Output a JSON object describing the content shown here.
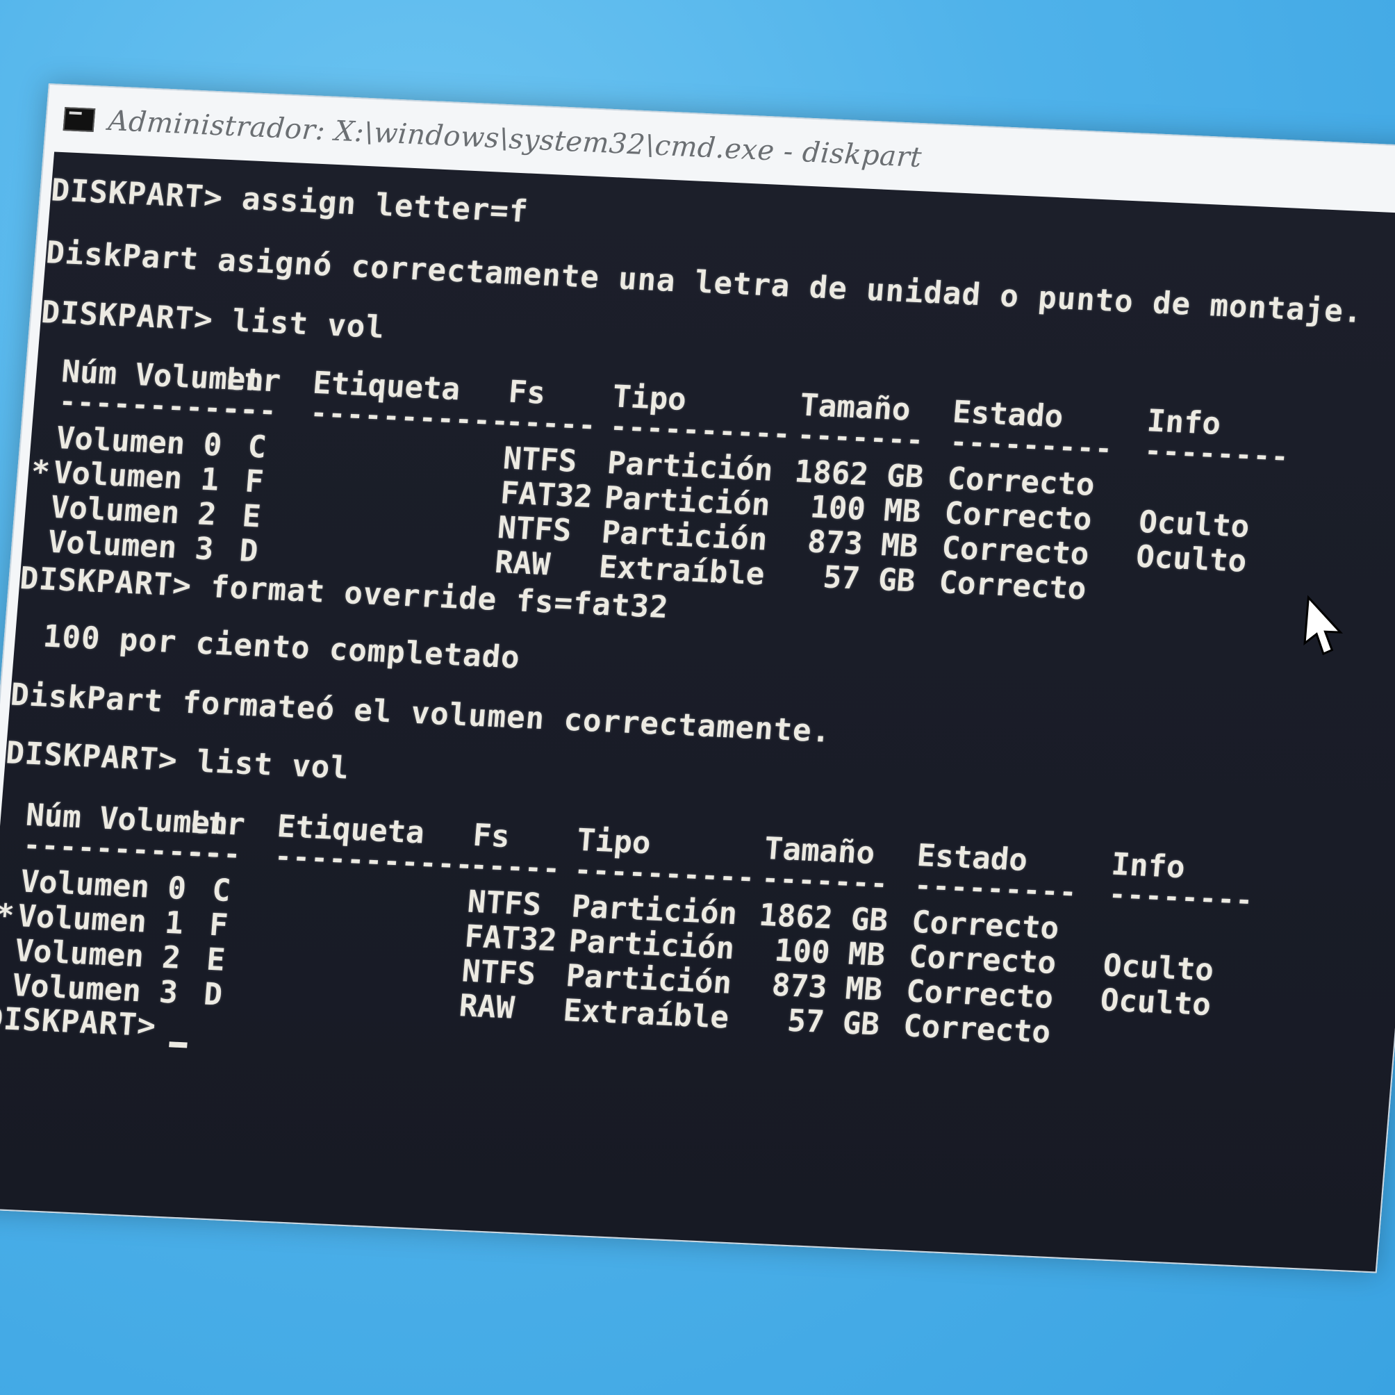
{
  "window": {
    "title": "Administrador: X:\\windows\\system32\\cmd.exe - diskpart"
  },
  "console": {
    "cmd1": "DISKPART> assign letter=f",
    "msg1": "DiskPart asignó correctamente una letra de unidad o punto de montaje.",
    "cmd2": "DISKPART> list vol",
    "cmd3": "DISKPART> format override fs=fat32",
    "progress": "100 por ciento completado",
    "msg2": "DiskPart formateó el volumen correctamente.",
    "cmd4": "DISKPART> list vol",
    "prompt": "DISKPART> "
  },
  "table": {
    "headers": {
      "num": "Núm Volumen",
      "ltr": "Ltr",
      "label": "Etiqueta",
      "fs": "Fs",
      "type": "Tipo",
      "size": "Tamaño",
      "status": "Estado",
      "info": "Info"
    },
    "dashes": {
      "num": "-----------",
      "ltr": "---",
      "label": "-----------",
      "fs": "-----",
      "type": "----------",
      "size": "-------",
      "status": "---------",
      "info": "--------"
    },
    "rows1": [
      {
        "marker": " ",
        "num": "Volumen 0",
        "ltr": "C",
        "label": "",
        "fs": "NTFS",
        "type": "Partición",
        "size": "1862 GB",
        "status": "Correcto",
        "info": ""
      },
      {
        "marker": "*",
        "num": "Volumen 1",
        "ltr": "F",
        "label": "",
        "fs": "FAT32",
        "type": "Partición",
        "size": " 100 MB",
        "status": "Correcto",
        "info": "Oculto"
      },
      {
        "marker": " ",
        "num": "Volumen 2",
        "ltr": "E",
        "label": "",
        "fs": "NTFS",
        "type": "Partición",
        "size": " 873 MB",
        "status": "Correcto",
        "info": "Oculto"
      },
      {
        "marker": " ",
        "num": "Volumen 3",
        "ltr": "D",
        "label": "",
        "fs": "RAW",
        "type": "Extraíble",
        "size": "  57 GB",
        "status": "Correcto",
        "info": ""
      }
    ],
    "rows2": [
      {
        "marker": " ",
        "num": "Volumen 0",
        "ltr": "C",
        "label": "",
        "fs": "NTFS",
        "type": "Partición",
        "size": "1862 GB",
        "status": "Correcto",
        "info": ""
      },
      {
        "marker": "*",
        "num": "Volumen 1",
        "ltr": "F",
        "label": "",
        "fs": "FAT32",
        "type": "Partición",
        "size": " 100 MB",
        "status": "Correcto",
        "info": "Oculto"
      },
      {
        "marker": " ",
        "num": "Volumen 2",
        "ltr": "E",
        "label": "",
        "fs": "NTFS",
        "type": "Partición",
        "size": " 873 MB",
        "status": "Correcto",
        "info": "Oculto"
      },
      {
        "marker": " ",
        "num": "Volumen 3",
        "ltr": "D",
        "label": "",
        "fs": "RAW",
        "type": "Extraíble",
        "size": "  57 GB",
        "status": "Correcto",
        "info": ""
      }
    ]
  },
  "colors": {
    "console_bg": "#1c1f2a",
    "console_text": "#eceae2",
    "titlebar_bg": "#f4f6f8",
    "title_text": "#6b6f73",
    "desktop_bg": "#4fb2ea"
  }
}
